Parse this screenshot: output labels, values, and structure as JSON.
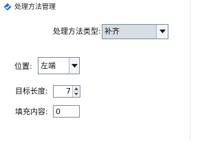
{
  "window": {
    "title": "处理方法管理",
    "icon": "app-icon"
  },
  "form": {
    "method_type": {
      "label": "处理方法类型:",
      "value": "补齐"
    },
    "position": {
      "label": "位置:",
      "value": "左端"
    },
    "target_length": {
      "label": "目标长度:",
      "value": "7"
    },
    "fill_content": {
      "label": "填充内容:",
      "value": "0"
    }
  },
  "colors": {
    "field_border": "#7a8aa0",
    "disabled_combo_bg": "#d9dde4",
    "icon_blue": "#2b6fd6"
  }
}
